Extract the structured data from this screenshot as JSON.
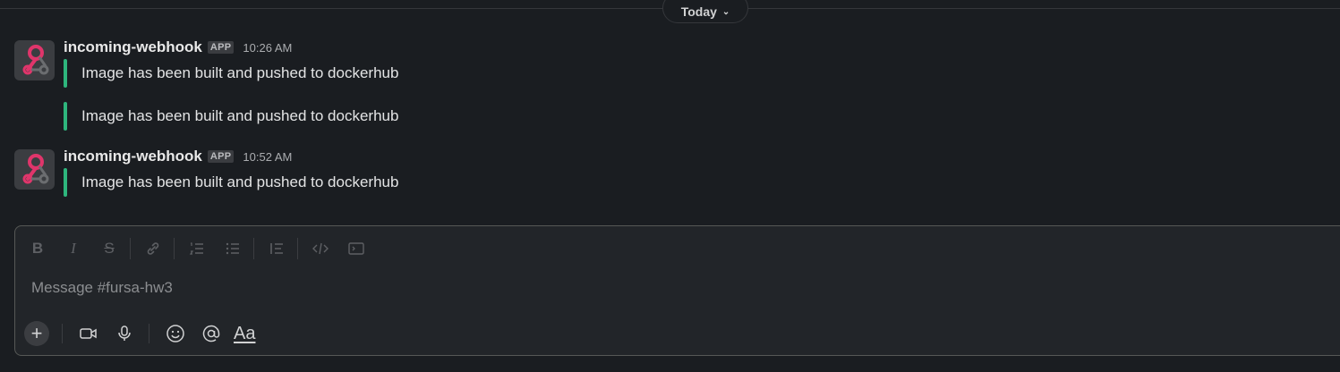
{
  "date_divider": {
    "label": "Today",
    "chevron_icon": "chevron-down-icon"
  },
  "messages": [
    {
      "sender": "incoming-webhook",
      "badge": "APP",
      "time": "10:26 AM",
      "attachments": [
        "Image has been built and pushed to dockerhub",
        "Image has been built and pushed to dockerhub"
      ]
    },
    {
      "sender": "incoming-webhook",
      "badge": "APP",
      "time": "10:52 AM",
      "attachments": [
        "Image has been built and pushed to dockerhub"
      ]
    }
  ],
  "composer": {
    "placeholder": "Message #fursa-hw3",
    "formatting_tools": [
      "bold-icon",
      "italic-icon",
      "strikethrough-icon",
      "link-icon",
      "ordered-list-icon",
      "bulleted-list-icon",
      "blockquote-icon",
      "code-icon",
      "code-block-icon"
    ],
    "actions": [
      "plus-icon",
      "video-icon",
      "microphone-icon",
      "emoji-icon",
      "mention-icon",
      "formatting-aa-icon"
    ],
    "format_label": "Aa"
  },
  "colors": {
    "background": "#1a1d21",
    "attachment_bar": "#2eb67d",
    "webhook_avatar_pink": "#e0356b"
  }
}
